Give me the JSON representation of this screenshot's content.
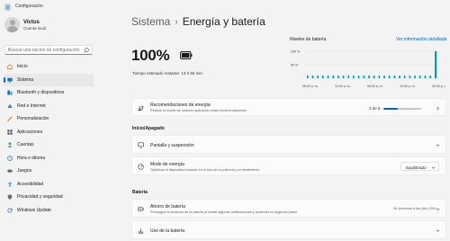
{
  "window": {
    "title": "Configuración"
  },
  "user": {
    "name": "Victus",
    "account_type": "Cuenta local"
  },
  "search": {
    "placeholder": "Buscar una opción de configuración"
  },
  "sidebar": {
    "items": [
      {
        "label": "Inicio",
        "icon": "home-icon",
        "color": "#d06a2a"
      },
      {
        "label": "Sistema",
        "icon": "system-icon",
        "color": "#0078d4",
        "active": true
      },
      {
        "label": "Bluetooth y dispositivos",
        "icon": "bluetooth-icon",
        "color": "#1f6fc5"
      },
      {
        "label": "Red e Internet",
        "icon": "network-icon",
        "color": "#3a7bd5"
      },
      {
        "label": "Personalización",
        "icon": "brush-icon",
        "color": "#c9732a"
      },
      {
        "label": "Aplicaciones",
        "icon": "apps-icon",
        "color": "#505a6b"
      },
      {
        "label": "Cuentas",
        "icon": "accounts-icon",
        "color": "#2ea043"
      },
      {
        "label": "Hora e idioma",
        "icon": "globe-clock-icon",
        "color": "#2b79c2"
      },
      {
        "label": "Juegos",
        "icon": "gamepad-icon",
        "color": "#606060"
      },
      {
        "label": "Accesibilidad",
        "icon": "accessibility-icon",
        "color": "#1f6fc5"
      },
      {
        "label": "Privacidad y seguridad",
        "icon": "shield-icon",
        "color": "#707070"
      },
      {
        "label": "Windows Update",
        "icon": "update-icon",
        "color": "#1f6fc5"
      }
    ]
  },
  "header": {
    "parent": "Sistema",
    "separator": "›",
    "current": "Energía y batería"
  },
  "battery": {
    "percent_text": "100%",
    "level": 1.0,
    "time_remaining": "Tiempo estimado restante: 13 h 55 min"
  },
  "levels": {
    "title": "Niveles de batería",
    "link": "Ver información detallada",
    "y_ticks": [
      "100 %",
      "50 %"
    ],
    "x_ticks": [
      "06:00 p. m.",
      "12:00 a. m.",
      "06:00 a. m.",
      "12:00 p. m.",
      "06:00 p. m."
    ],
    "bar_count": 26,
    "latest_level": 1.0,
    "accent": "#0099bc"
  },
  "recommendations": {
    "title": "Recomendaciones de energía",
    "subtitle": "Reduce la huella de carbono aplicando estas recomendaciones",
    "count": "3 de 8",
    "progress": 0.375
  },
  "sections": {
    "power": "Inicio/Apagado",
    "battery": "Batería"
  },
  "screen_sleep": {
    "title": "Pantalla y suspensión"
  },
  "power_mode": {
    "title": "Modo de energía",
    "subtitle": "Optimizar el dispositivo basado en el uso de la potencia y el rendimiento",
    "value": "Equilibrado"
  },
  "battery_saver": {
    "title": "Ahorro de batería",
    "subtitle": "Prolongue la duración de la batería al limitar algunas notificaciones y actividad en segundo plano",
    "status": "Se enciende a las (sic) 20%"
  },
  "battery_usage": {
    "title": "Uso de la batería"
  }
}
